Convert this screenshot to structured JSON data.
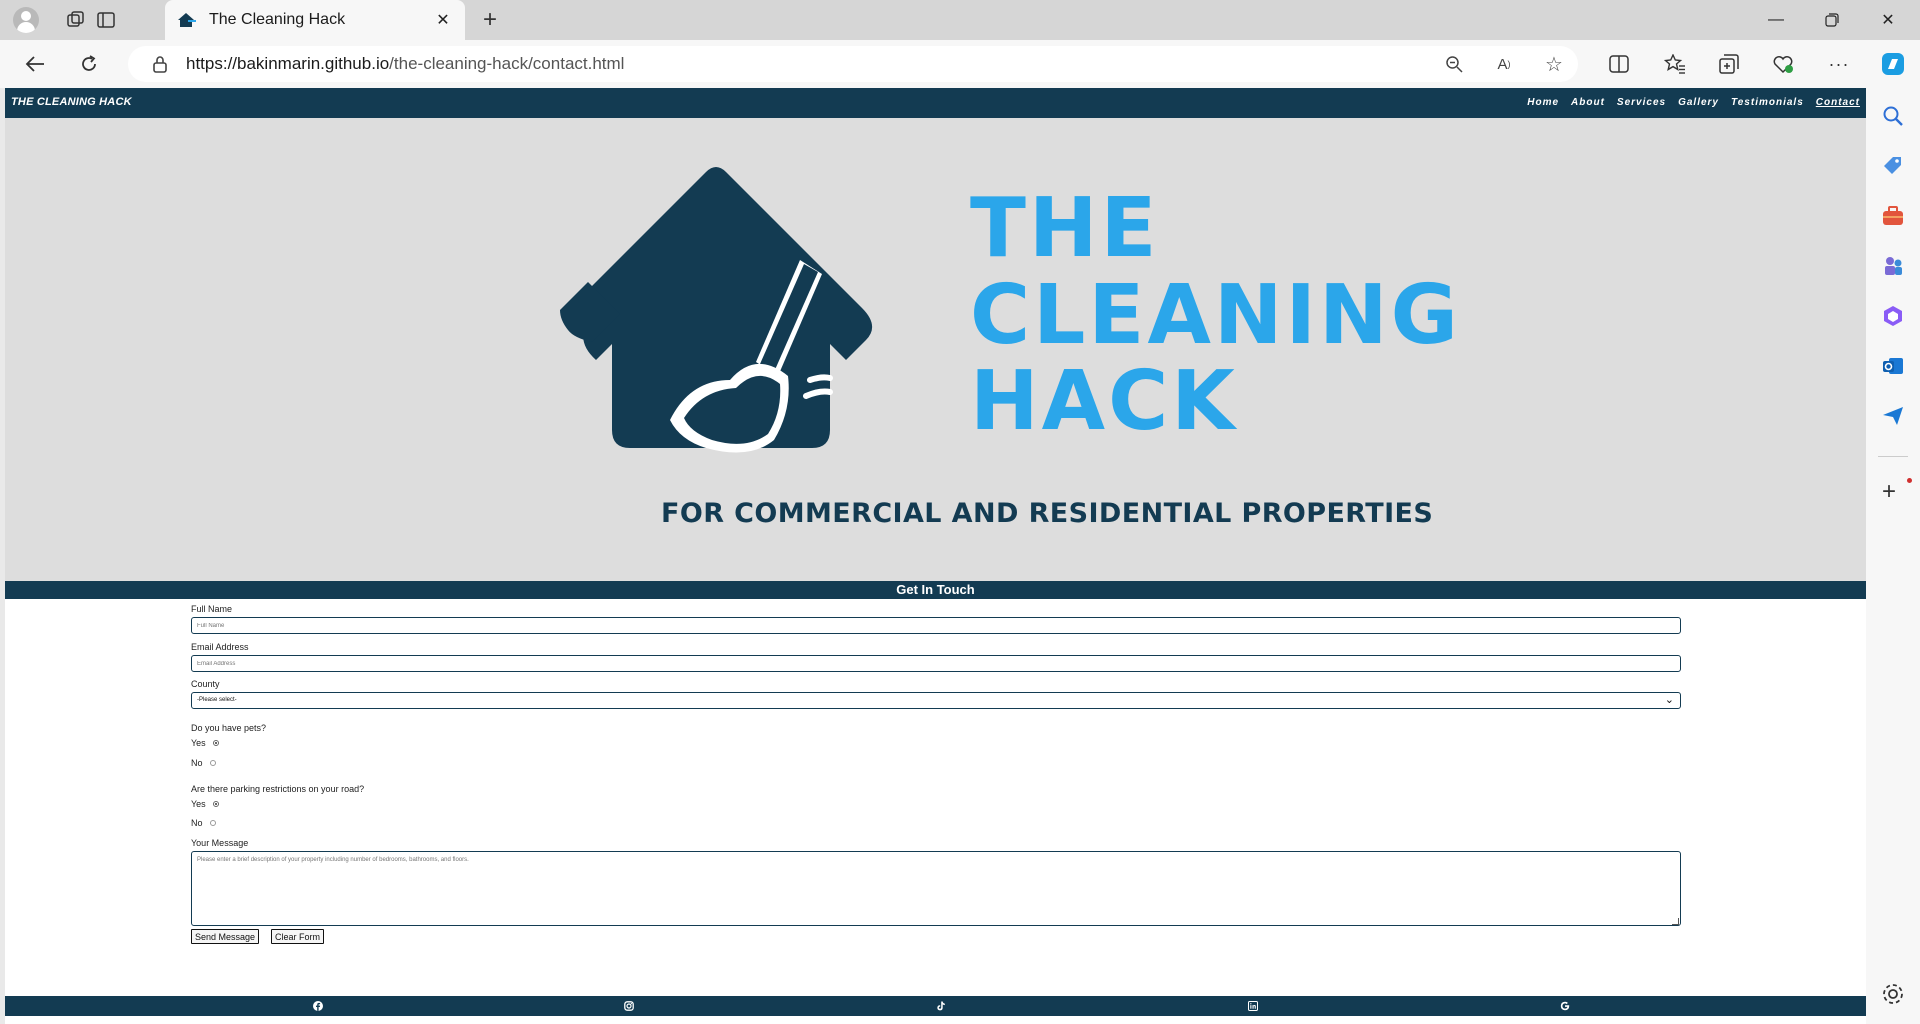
{
  "browser": {
    "tab_title": "The Cleaning Hack",
    "url_host": "https://bakinmarin.github.io",
    "url_path": "/the-cleaning-hack/contact.html"
  },
  "site": {
    "brand": "THE CLEANING HACK",
    "menu": [
      {
        "label": "Home"
      },
      {
        "label": "About"
      },
      {
        "label": "Services"
      },
      {
        "label": "Gallery"
      },
      {
        "label": "Testimonials"
      },
      {
        "label": "Contact",
        "active": true
      }
    ],
    "logo": {
      "word1": "THE",
      "word2": "CLEANING",
      "word3": "HACK",
      "tagline": "FOR COMMERCIAL AND RESIDENTIAL PROPERTIES",
      "accent": "#2ba6ea",
      "brand_dark": "#133b52"
    }
  },
  "contact": {
    "heading": "Get In Touch",
    "full_name_label": "Full Name",
    "full_name_placeholder": "Full Name",
    "email_label": "Email Address",
    "email_placeholder": "Email Address",
    "county_label": "County",
    "county_selected": "-Please select-",
    "pets_question": "Do you have pets?",
    "pets_yes": "Yes",
    "pets_no": "No",
    "parking_question": "Are there parking restrictions on your road?",
    "parking_yes": "Yes",
    "parking_no": "No",
    "message_label": "Your Message",
    "message_placeholder": "Please enter a brief description of your property including number of bedrooms, bathrooms, and floors.",
    "send_label": "Send Message",
    "clear_label": "Clear Form"
  },
  "footer": {
    "social": [
      "facebook-icon",
      "instagram-icon",
      "tiktok-icon",
      "linkedin-icon",
      "google-icon"
    ]
  }
}
